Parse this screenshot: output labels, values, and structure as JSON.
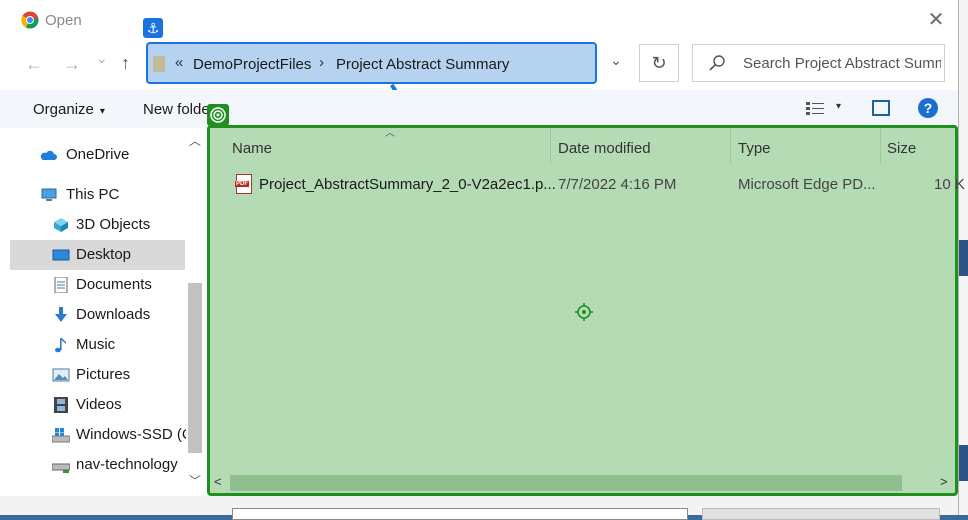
{
  "window": {
    "title": "Open",
    "close_glyph": "✕"
  },
  "nav": {
    "back_glyph": "←",
    "forward_glyph": "→",
    "recent_glyph": "⌄",
    "up_glyph": "↑"
  },
  "address": {
    "overflow_glyph": "«",
    "segments": [
      "DemoProjectFiles",
      "Project Abstract Summary"
    ],
    "separator_glyph": "›",
    "dropdown_glyph": "⌄",
    "refresh_glyph": "↻"
  },
  "search": {
    "placeholder": "Search Project Abstract Summary"
  },
  "toolbar": {
    "organize_label": "Organize",
    "new_folder_label": "New folder",
    "caret": "▾",
    "help_label": "?"
  },
  "sidebar": {
    "items": [
      {
        "label": "OneDrive",
        "icon": "cloud-icon"
      },
      {
        "label": "This PC",
        "icon": "computer-icon"
      },
      {
        "label": "3D Objects",
        "icon": "cube-icon"
      },
      {
        "label": "Desktop",
        "icon": "desktop-icon",
        "selected": true
      },
      {
        "label": "Documents",
        "icon": "document-icon"
      },
      {
        "label": "Downloads",
        "icon": "download-icon"
      },
      {
        "label": "Music",
        "icon": "music-icon"
      },
      {
        "label": "Pictures",
        "icon": "picture-icon"
      },
      {
        "label": "Videos",
        "icon": "film-icon"
      },
      {
        "label": "Windows-SSD (C",
        "icon": "drive-icon"
      },
      {
        "label": "nav-technology",
        "icon": "network-drive-icon"
      }
    ]
  },
  "file_list": {
    "columns": [
      "Name",
      "Date modified",
      "Type",
      "Size"
    ],
    "rows": [
      {
        "name": "Project_AbstractSummary_2_0-V2a2ec1.p...",
        "date_modified": "7/7/2022 4:16 PM",
        "type": "Microsoft Edge PD...",
        "size": "10 K"
      }
    ]
  },
  "overlays": {
    "anchor_glyph": "⚓",
    "colors": {
      "anchor": "#1b73e0",
      "target": "#1f8f1f"
    }
  }
}
